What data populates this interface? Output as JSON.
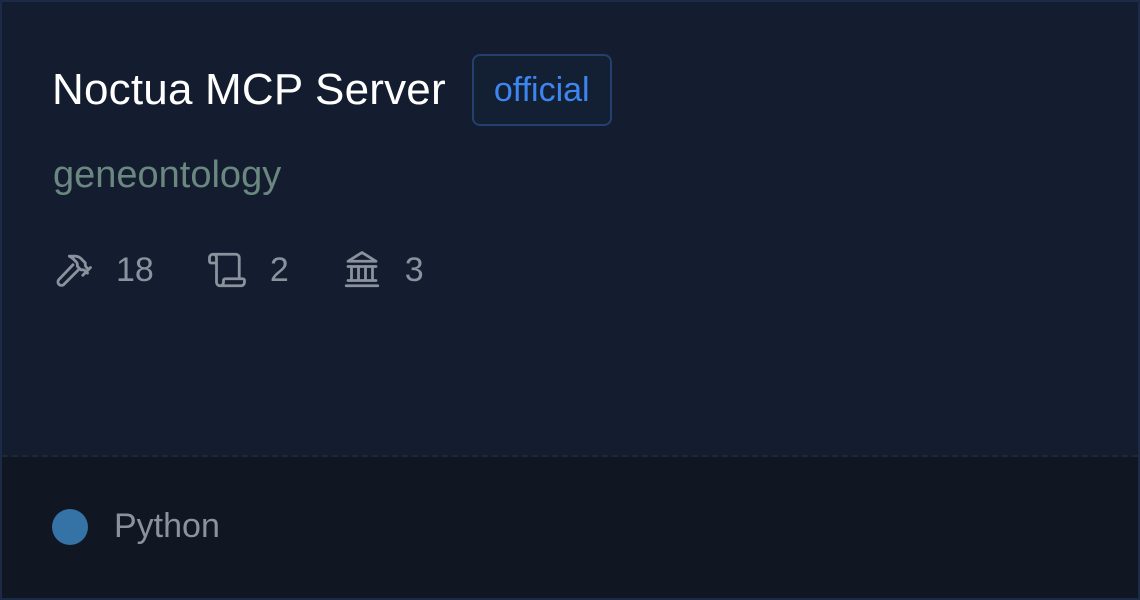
{
  "server": {
    "name": "Noctua MCP Server",
    "badge": "official",
    "owner": "geneontology"
  },
  "stats": {
    "tools": {
      "icon": "hammer-icon",
      "value": "18"
    },
    "prompts": {
      "icon": "scroll-icon",
      "value": "2"
    },
    "resources": {
      "icon": "bank-icon",
      "value": "3"
    }
  },
  "footer": {
    "language": "Python",
    "language_color": "#3572a5"
  },
  "colors": {
    "badge_text": "#3d86f0",
    "owner_text": "#6a8780",
    "stat_text": "#8a929e"
  }
}
